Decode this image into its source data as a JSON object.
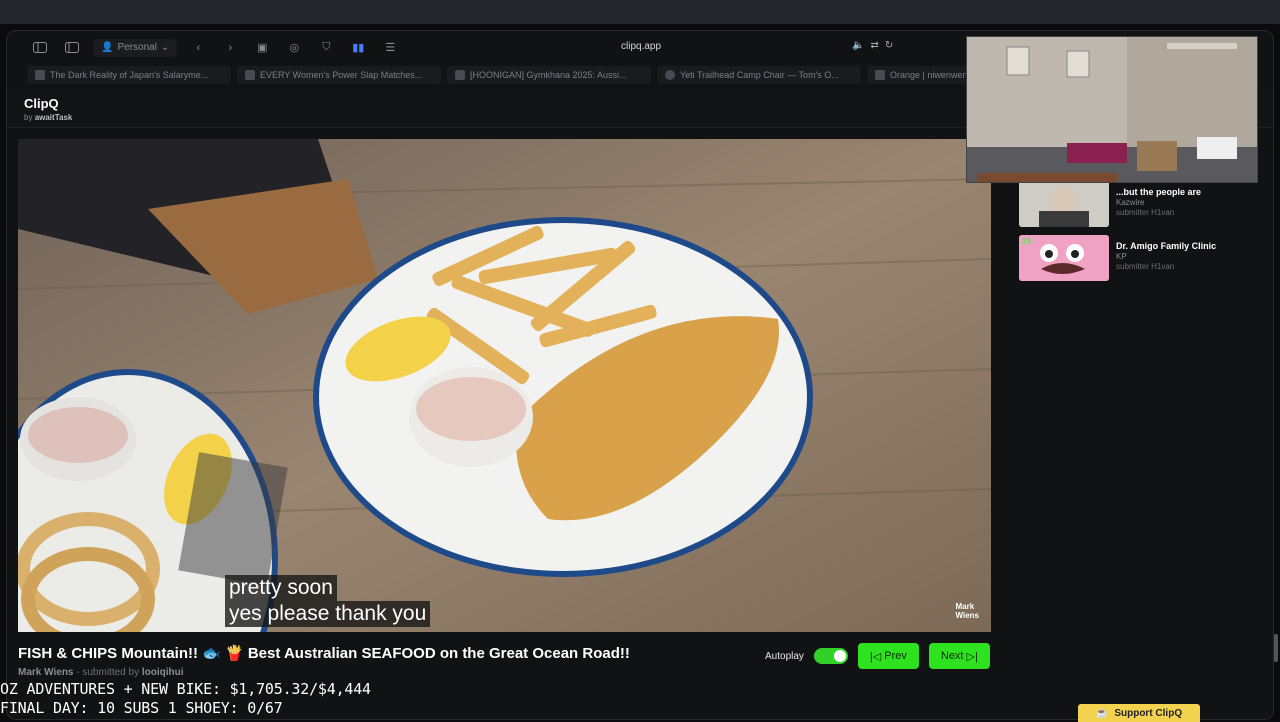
{
  "browser": {
    "profile": "Personal",
    "url": "clipq.app",
    "tabs": [
      {
        "label": "The Dark Reality of Japan's Salaryme..."
      },
      {
        "label": "EVERY Women's Power Slap Matches..."
      },
      {
        "label": "[HOONIGAN] Gymkhana 2025: Aussi..."
      },
      {
        "label": "Yeti Trailhead Camp Chair — Tom's O..."
      },
      {
        "label": "Orange | niwenwen"
      }
    ]
  },
  "app": {
    "title": "ClipQ",
    "by_prefix": "by",
    "by_author": "awaitTask"
  },
  "video": {
    "caption_line1": "pretty soon",
    "caption_line2": "yes please thank you",
    "watermark_line1": "Mark",
    "watermark_line2": "Wiens",
    "title": "FISH & CHIPS Mountain!! 🐟 🍟 Best Australian SEAFOOD on the Great Ocean Road!!",
    "channel": "Mark Wiens",
    "submitted_prefix": "- submitted by",
    "submitter": "looiqihui"
  },
  "controls": {
    "autoplay_label": "Autoplay",
    "autoplay_on": true,
    "prev_label": "Prev",
    "next_label": "Next"
  },
  "queue": [
    {
      "title": "...but the people are",
      "channel": "Kazwire",
      "submitter": "submitter H1van",
      "badge": ""
    },
    {
      "title": "Dr. Amigo Family Clinic",
      "channel": "KP",
      "submitter": "submitter H1van",
      "badge": "29"
    }
  ],
  "stream_overlay": {
    "line1": "OZ ADVENTURES + NEW BIKE: $1,705.32/$4,444",
    "line2": "FINAL DAY: 10 SUBS 1 SHOEY: 0/67"
  },
  "support_label": "Support ClipQ",
  "colors": {
    "accent_green": "#2fe21f",
    "toggle_green": "#33d02a",
    "support_yellow": "#f2d24e"
  }
}
